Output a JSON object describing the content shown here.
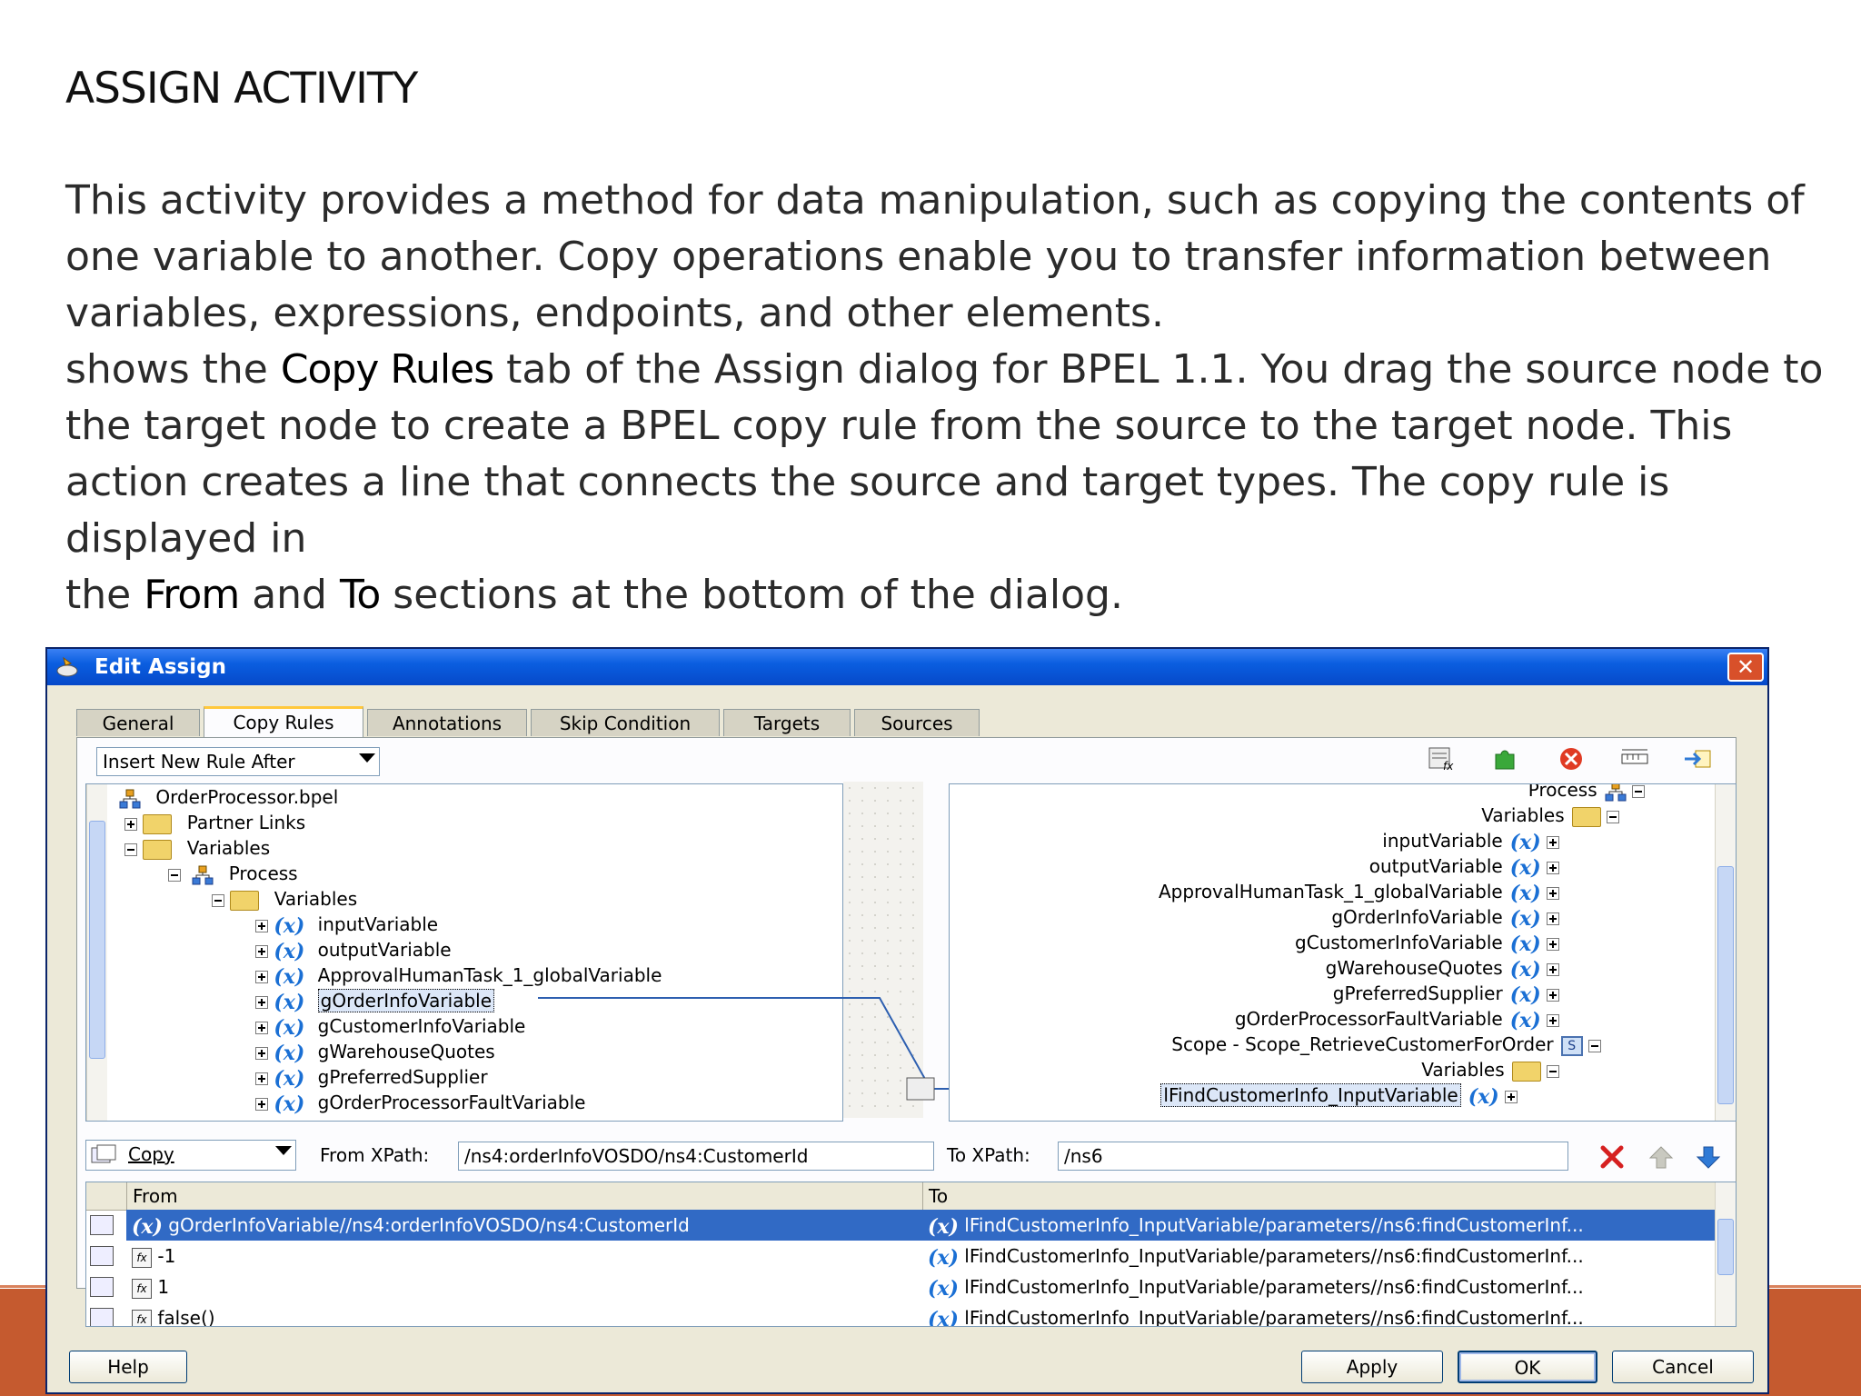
{
  "slide": {
    "title": "ASSIGN ACTIVITY",
    "para1": "This activity provides a method for data manipulation, such as copying the contents of one variable to another. Copy operations enable you to transfer information between variables, expressions, endpoints, and other elements.",
    "para2_a": "shows the ",
    "para2_b": "Copy Rules",
    "para2_c": " tab of the Assign dialog for BPEL 1.1. You drag the source node to the target node to create a BPEL copy rule from the source to the target node. This action creates a line that connects the source and target types. The copy rule is displayed in",
    "para3_a": "the ",
    "para3_b": "From",
    "para3_c": " and ",
    "para3_d": "To",
    "para3_e": " sections at the bottom of the dialog."
  },
  "dialog": {
    "title": "Edit Assign",
    "close_glyph": "✕",
    "tabs": [
      "General",
      "Copy Rules",
      "Annotations",
      "Skip Condition",
      "Targets",
      "Sources"
    ],
    "insert_mode": "Insert New Rule After",
    "source_tree": [
      {
        "label": "OrderProcessor.bpel",
        "icon": "process-icon"
      },
      {
        "label": "Partner Links",
        "icon": "folder-icon"
      },
      {
        "label": "Variables",
        "icon": "folder-icon"
      },
      {
        "label": "Process",
        "icon": "process-icon"
      },
      {
        "label": "Variables",
        "icon": "folder-icon"
      },
      {
        "label": "inputVariable",
        "icon": "variable-icon"
      },
      {
        "label": "outputVariable",
        "icon": "variable-icon"
      },
      {
        "label": "ApprovalHumanTask_1_globalVariable",
        "icon": "variable-icon"
      },
      {
        "label": "gOrderInfoVariable",
        "icon": "variable-icon"
      },
      {
        "label": "gCustomerInfoVariable",
        "icon": "variable-icon"
      },
      {
        "label": "gWarehouseQuotes",
        "icon": "variable-icon"
      },
      {
        "label": "gPreferredSupplier",
        "icon": "variable-icon"
      },
      {
        "label": "gOrderProcessorFaultVariable",
        "icon": "variable-icon"
      }
    ],
    "target_tree": [
      {
        "label": "Process",
        "icon": "process-icon"
      },
      {
        "label": "Variables",
        "icon": "folder-icon"
      },
      {
        "label": "inputVariable",
        "icon": "variable-icon"
      },
      {
        "label": "outputVariable",
        "icon": "variable-icon"
      },
      {
        "label": "ApprovalHumanTask_1_globalVariable",
        "icon": "variable-icon"
      },
      {
        "label": "gOrderInfoVariable",
        "icon": "variable-icon"
      },
      {
        "label": "gCustomerInfoVariable",
        "icon": "variable-icon"
      },
      {
        "label": "gWarehouseQuotes",
        "icon": "variable-icon"
      },
      {
        "label": "gPreferredSupplier",
        "icon": "variable-icon"
      },
      {
        "label": "gOrderProcessorFaultVariable",
        "icon": "variable-icon"
      },
      {
        "label": "Scope - Scope_RetrieveCustomerForOrder",
        "icon": "scope-icon"
      },
      {
        "label": "Variables",
        "icon": "folder-icon"
      },
      {
        "label": "lFindCustomerInfo_InputVariable",
        "icon": "variable-icon"
      }
    ],
    "variable_glyph": "(x)",
    "copy_mode": "Copy",
    "from_xpath_label": "From XPath:",
    "from_xpath_value": "/ns4:orderInfoVOSDO/ns4:CustomerId",
    "to_xpath_label": "To XPath:",
    "to_xpath_value": "/ns6",
    "grid": {
      "col_from": "From",
      "col_to": "To",
      "rows": [
        {
          "from": "gOrderInfoVariable//ns4:orderInfoVOSDO/ns4:CustomerId",
          "to": "lFindCustomerInfo_InputVariable/parameters//ns6:findCustomerInf..."
        },
        {
          "from": "-1",
          "to": "lFindCustomerInfo_InputVariable/parameters//ns6:findCustomerInf..."
        },
        {
          "from": "1",
          "to": "lFindCustomerInfo_InputVariable/parameters//ns6:findCustomerInf..."
        },
        {
          "from": "false()",
          "to": "lFindCustomerInfo_InputVariable/parameters//ns6:findCustomerInf..."
        }
      ]
    },
    "buttons": {
      "help": "Help",
      "apply": "Apply",
      "ok": "OK",
      "cancel": "Cancel"
    },
    "colors": {
      "titlebar": "#0a5ee0",
      "selection": "#316ac5",
      "accent_band": "#c55a2f",
      "delete": "#d62020",
      "move": "#2f7ad6"
    }
  }
}
